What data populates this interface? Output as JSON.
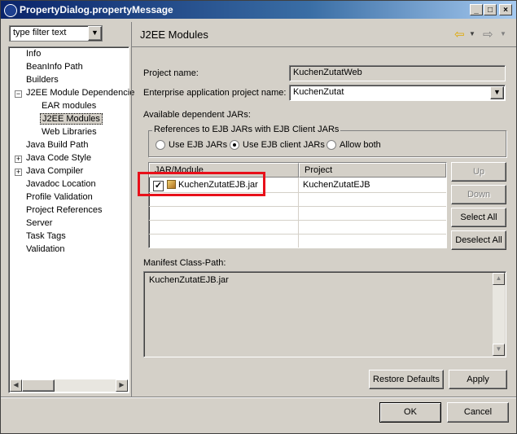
{
  "window": {
    "title": "PropertyDialog.propertyMessage"
  },
  "filter": {
    "value": "type filter text"
  },
  "tree": {
    "items": [
      "Info",
      "BeanInfo Path",
      "Builders",
      "J2EE Module Dependencie",
      "EAR modules",
      "J2EE Modules",
      "Web Libraries",
      "Java Build Path",
      "Java Code Style",
      "Java Compiler",
      "Javadoc Location",
      "Profile Validation",
      "Project References",
      "Server",
      "Task Tags",
      "Validation"
    ],
    "selected": "J2EE Modules"
  },
  "page": {
    "title": "J2EE Modules",
    "project_label": "Project name:",
    "project_value": "KuchenZutatWeb",
    "ear_label": "Enterprise application project name:",
    "ear_value": "KuchenZutat",
    "available_label": "Available dependent JARs:",
    "group_label": "References to EJB JARs with EJB Client JARs",
    "radio": {
      "use_ejb": "Use EJB JARs",
      "use_client": "Use EJB client JARs",
      "allow_both": "Allow both",
      "selected": "use_client"
    },
    "table": {
      "col_jar": "JAR/Module",
      "col_project": "Project",
      "rows": [
        {
          "checked": true,
          "jar": "KuchenZutatEJB.jar",
          "project": "KuchenZutatEJB"
        }
      ]
    },
    "buttons": {
      "up": "Up",
      "down": "Down",
      "select_all": "Select All",
      "deselect_all": "Deselect All"
    },
    "manifest_label": "Manifest Class-Path:",
    "manifest_value": "KuchenZutatEJB.jar",
    "restore": "Restore Defaults",
    "apply": "Apply"
  },
  "footer": {
    "ok": "OK",
    "cancel": "Cancel"
  },
  "colors": {
    "highlight_box": "#e8101a",
    "title_start": "#0a246a",
    "title_end": "#a6caf0",
    "tree_selected": "#d4d0c8"
  }
}
